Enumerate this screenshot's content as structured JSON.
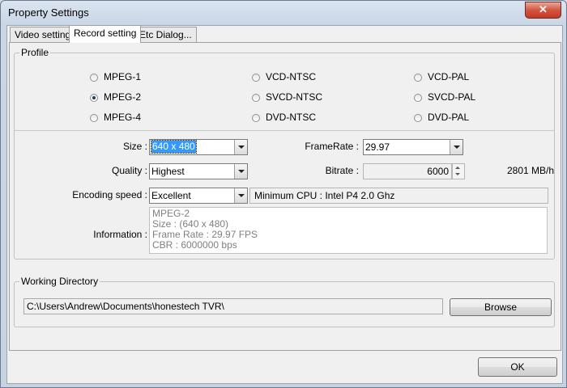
{
  "window": {
    "title": "Property Settings",
    "close_glyph": "✕"
  },
  "tabs": [
    {
      "label": "Video setting"
    },
    {
      "label": "Record setting"
    },
    {
      "label": "Etc Dialog..."
    }
  ],
  "profile": {
    "legend": "Profile",
    "options": [
      {
        "label": "MPEG-1",
        "selected": false
      },
      {
        "label": "VCD-NTSC",
        "selected": false
      },
      {
        "label": "VCD-PAL",
        "selected": false
      },
      {
        "label": "MPEG-2",
        "selected": true
      },
      {
        "label": "SVCD-NTSC",
        "selected": false
      },
      {
        "label": "SVCD-PAL",
        "selected": false
      },
      {
        "label": "MPEG-4",
        "selected": false
      },
      {
        "label": "DVD-NTSC",
        "selected": false
      },
      {
        "label": "DVD-PAL",
        "selected": false
      }
    ],
    "size_label": "Size :",
    "size_value": "640 x 480",
    "framerate_label": "FrameRate :",
    "framerate_value": "29.97",
    "quality_label": "Quality :",
    "quality_value": "Highest",
    "bitrate_label": "Bitrate :",
    "bitrate_value": "6000",
    "bitrate_size": "2801 MB/h",
    "encoding_label": "Encoding speed :",
    "encoding_value": "Excellent",
    "min_cpu": "Minimum CPU : Intel P4 2.0 Ghz",
    "information_label": "Information :",
    "information_lines": [
      "MPEG-2",
      "Size : (640 x 480)",
      "Frame Rate : 29.97 FPS",
      "CBR : 6000000 bps"
    ]
  },
  "working_directory": {
    "legend": "Working Directory",
    "path": "C:\\Users\\Andrew\\Documents\\honestech TVR\\",
    "browse_label": "Browse"
  },
  "footer": {
    "ok_label": "OK"
  }
}
